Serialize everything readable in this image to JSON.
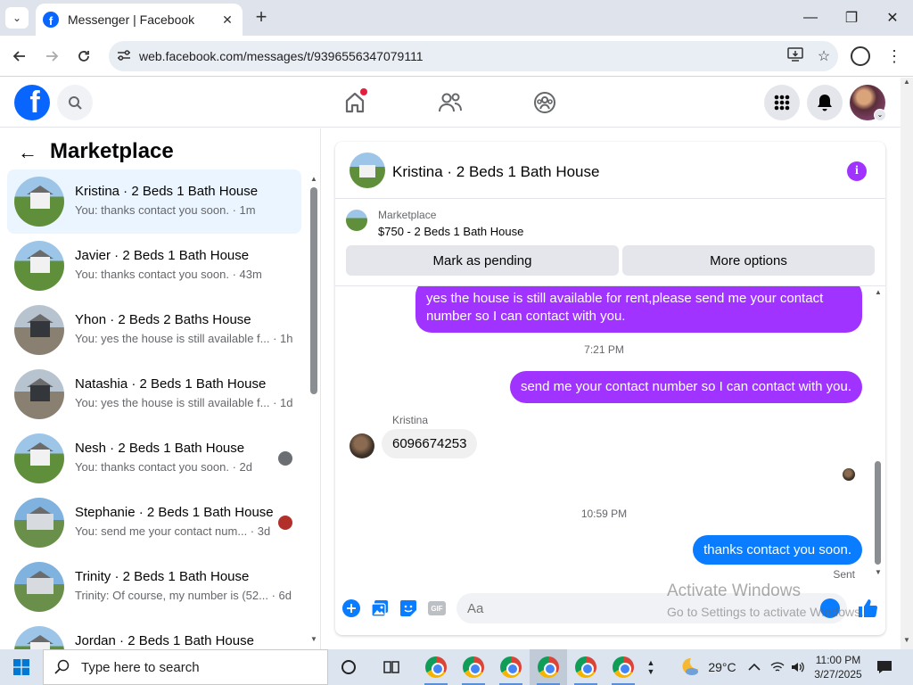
{
  "browser": {
    "tab_title": "Messenger | Facebook",
    "tab_close": "✕",
    "new_tab": "+",
    "url": "web.facebook.com/messages/t/9396556347079111",
    "min": "—",
    "max": "❐",
    "close": "✕"
  },
  "fb_header": {
    "logo_letter": "f"
  },
  "marketplace": {
    "title": "Marketplace",
    "back": "←",
    "conversations": [
      {
        "title": "Kristina · 2 Beds 1 Bath House",
        "subtitle": "You: thanks contact you soon. · 1m",
        "active": true
      },
      {
        "title": "Javier · 2 Beds 1 Bath House",
        "subtitle": "You: thanks contact you soon. · 43m"
      },
      {
        "title": "Yhon · 2 Beds 2 Baths House",
        "subtitle": "You: yes the house is still available f... · 1h"
      },
      {
        "title": "Natashia · 2 Beds 1 Bath House",
        "subtitle": "You: yes the house is still available f... · 1d"
      },
      {
        "title": "Nesh · 2 Beds 1 Bath House",
        "subtitle": "You: thanks contact you soon. · 2d"
      },
      {
        "title": "Stephanie · 2 Beds 1 Bath House",
        "subtitle": "You: send me your contact num... · 3d"
      },
      {
        "title": "Trinity · 2 Beds 1 Bath House",
        "subtitle": "Trinity: Of course, my number is (52... · 6d"
      },
      {
        "title": "Jordan · 2 Beds 1 Bath House",
        "subtitle": ""
      }
    ]
  },
  "conversation": {
    "title": "Kristina · 2 Beds 1 Bath House",
    "info_icon": "i",
    "listing_label": "Marketplace",
    "listing_price": "$750 - 2 Beds 1 Bath House",
    "mark_pending": "Mark as pending",
    "more_options": "More options",
    "messages": {
      "partial_out": "yes the house is still available for rent,please send me your contact number so I can contact with you.",
      "time1": "7:21 PM",
      "out1": "send me your contact number so I can contact with you.",
      "sender": "Kristina",
      "in1": "6096674253",
      "time2": "10:59 PM",
      "out2": "thanks contact you soon.",
      "status": "Sent"
    },
    "composer_placeholder": "Aa",
    "gif_label": "GIF"
  },
  "watermark": {
    "line1": "Activate Windows",
    "line2": "Go to Settings to activate Windows."
  },
  "taskbar": {
    "search_placeholder": "Type here to search",
    "weather": "29°C",
    "time": "11:00 PM",
    "date": "3/27/2025"
  },
  "colors": {
    "fb_blue": "#0866ff",
    "purple_bubble": "#a033ff",
    "blue_bubble": "#0a7cff",
    "active_row": "#ebf5ff"
  }
}
